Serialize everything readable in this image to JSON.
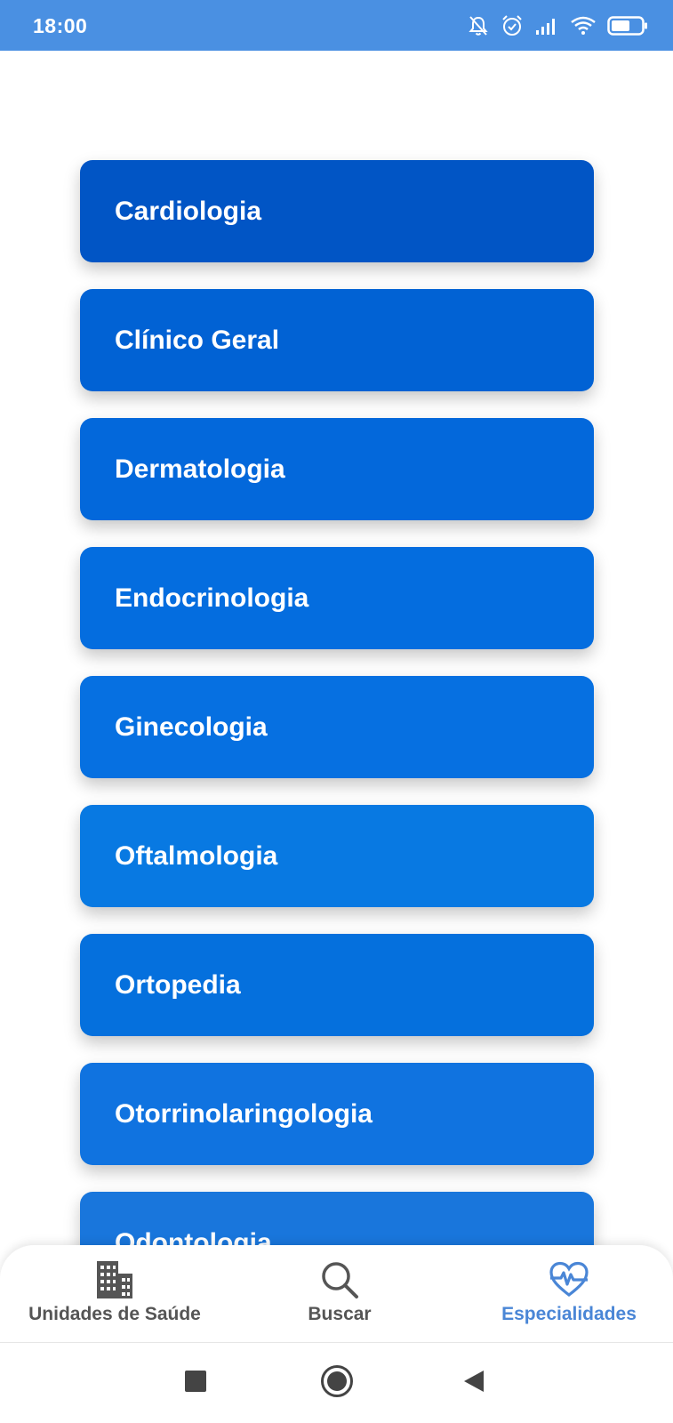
{
  "status_bar": {
    "time": "18:00",
    "color": "#4a90e2",
    "icons": [
      "bell-off-icon",
      "alarm-icon",
      "signal-icon",
      "wifi-icon",
      "battery-icon"
    ]
  },
  "specialties": [
    {
      "label": "Cardiologia",
      "color": "#0155c5"
    },
    {
      "label": "Clínico Geral",
      "color": "#0162d4"
    },
    {
      "label": "Dermatologia",
      "color": "#0368db"
    },
    {
      "label": "Endocrinologia",
      "color": "#046ddf"
    },
    {
      "label": "Ginecologia",
      "color": "#0670e1"
    },
    {
      "label": "Oftalmologia",
      "color": "#0879e2"
    },
    {
      "label": "Ortopedia",
      "color": "#0570dd"
    },
    {
      "label": "Otorrinolaringologia",
      "color": "#1073e0"
    },
    {
      "label": "Odontologia",
      "color": "#1976dc"
    }
  ],
  "bottom_nav": {
    "tabs": [
      {
        "label": "Unidades de Saúde",
        "icon": "building-icon",
        "active": false
      },
      {
        "label": "Buscar",
        "icon": "search-icon",
        "active": false
      },
      {
        "label": "Especialidades",
        "icon": "heart-pulse-icon",
        "active": true
      }
    ],
    "active_color": "#4a86d6"
  },
  "system_nav": {
    "buttons": [
      "recents-icon",
      "home-icon",
      "back-icon"
    ]
  }
}
